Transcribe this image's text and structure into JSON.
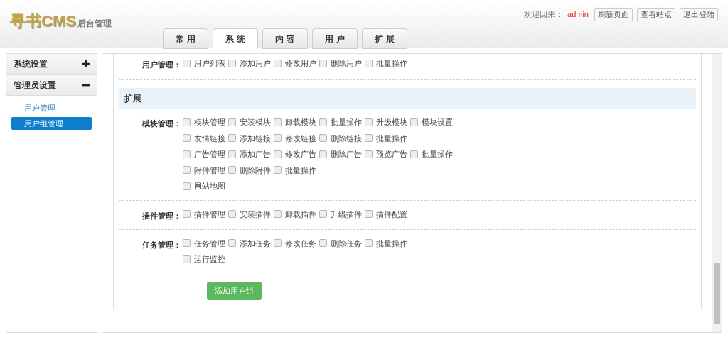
{
  "header": {
    "logo_main": "寻书CMS",
    "logo_sub": "后台管理",
    "welcome": "欢迎回来：",
    "user": "admin",
    "buttons": [
      "刷新页面",
      "查看站点",
      "退出登陆"
    ]
  },
  "tabs": [
    {
      "label": "常 用",
      "selected": false
    },
    {
      "label": "系 统",
      "selected": true
    },
    {
      "label": "内 容",
      "selected": false
    },
    {
      "label": "用 户",
      "selected": false
    },
    {
      "label": "扩 展",
      "selected": false
    }
  ],
  "sidebar": [
    {
      "label": "系统设置",
      "expanded": false
    },
    {
      "label": "管理员设置",
      "expanded": true,
      "children": [
        {
          "label": "用户管理",
          "selected": false
        },
        {
          "label": "用户组管理",
          "selected": true
        }
      ]
    }
  ],
  "top_group": {
    "label": "用户管理：",
    "lines": [
      [
        {
          "label": "用户列表",
          "checked": false
        },
        {
          "label": "添加用户",
          "checked": false
        },
        {
          "label": "修改用户",
          "checked": false
        },
        {
          "label": "删除用户",
          "checked": false
        },
        {
          "label": "批量操作",
          "checked": false
        }
      ]
    ]
  },
  "section": {
    "title": "扩展",
    "groups": [
      {
        "label": "模块管理：",
        "lines": [
          [
            {
              "label": "模块管理",
              "checked": false
            },
            {
              "label": "安装模块",
              "checked": false
            },
            {
              "label": "卸载模块",
              "checked": false
            },
            {
              "label": "批量操作",
              "checked": false
            },
            {
              "label": "升级模块",
              "checked": false
            },
            {
              "label": "模块设置",
              "checked": false
            }
          ],
          [
            {
              "label": "友情链接",
              "checked": false
            },
            {
              "label": "添加链接",
              "checked": false
            },
            {
              "label": "修改链接",
              "checked": false
            },
            {
              "label": "删除链接",
              "checked": false
            },
            {
              "label": "批量操作",
              "checked": false
            }
          ],
          [
            {
              "label": "广告管理",
              "checked": false
            },
            {
              "label": "添加广告",
              "checked": false
            },
            {
              "label": "修改广告",
              "checked": false
            },
            {
              "label": "删除广告",
              "checked": false
            },
            {
              "label": "预览广告",
              "checked": false
            },
            {
              "label": "批量操作",
              "checked": false
            }
          ],
          [
            {
              "label": "附件管理",
              "checked": false
            },
            {
              "label": "删除附件",
              "checked": false
            },
            {
              "label": "批量操作",
              "checked": false
            }
          ],
          [
            {
              "label": "网站地图",
              "checked": false
            }
          ]
        ]
      },
      {
        "label": "插件管理：",
        "lines": [
          [
            {
              "label": "插件管理",
              "checked": false
            },
            {
              "label": "安装插件",
              "checked": false
            },
            {
              "label": "卸载插件",
              "checked": false
            },
            {
              "label": "升级插件",
              "checked": false
            },
            {
              "label": "插件配置",
              "checked": false
            }
          ]
        ]
      },
      {
        "label": "任务管理：",
        "lines": [
          [
            {
              "label": "任务管理",
              "checked": false
            },
            {
              "label": "添加任务",
              "checked": false
            },
            {
              "label": "修改任务",
              "checked": false
            },
            {
              "label": "删除任务",
              "checked": false
            },
            {
              "label": "批量操作",
              "checked": false
            }
          ],
          [
            {
              "label": "运行监控",
              "checked": false
            }
          ]
        ]
      }
    ]
  },
  "submit": "添加用户组"
}
